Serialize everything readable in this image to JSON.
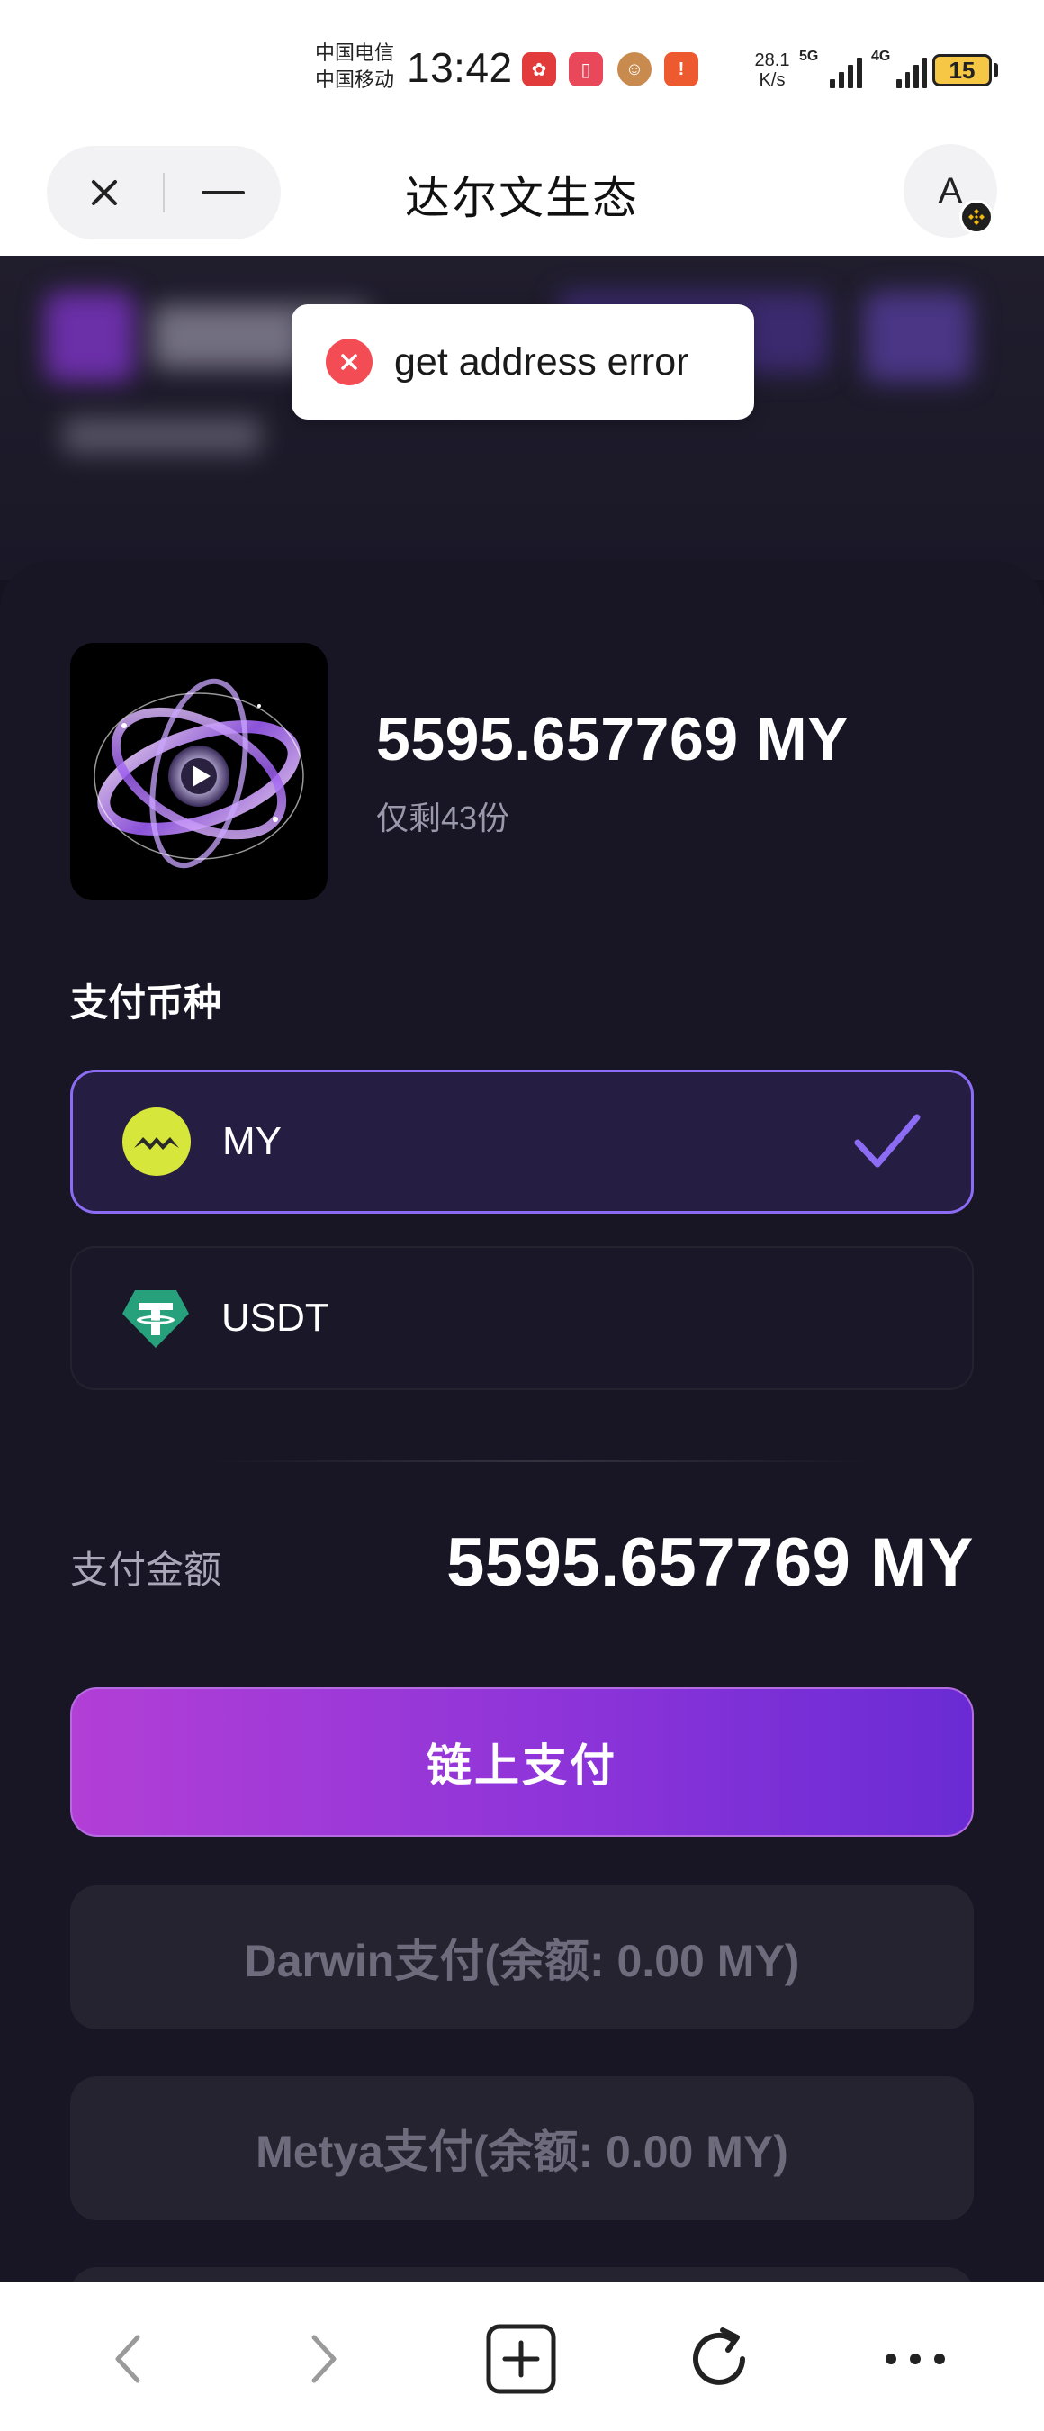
{
  "status_bar": {
    "carrier_1": "中国电信",
    "carrier_2": "中国移动",
    "time": "13:42",
    "net_speed_value": "28.1",
    "net_speed_unit": "K/s",
    "signal_1_label": "5G",
    "signal_2_label": "4G",
    "battery": "15"
  },
  "browser": {
    "title": "达尔文生态",
    "avatar_letter": "A"
  },
  "toast": {
    "message": "get address error"
  },
  "product": {
    "price": "5595.657769 MY",
    "remaining": "仅剩43份"
  },
  "payment_currency": {
    "label": "支付币种",
    "options": [
      {
        "label": "MY",
        "icon": "my-coin-icon",
        "selected": true
      },
      {
        "label": "USDT",
        "icon": "usdt-icon",
        "selected": false
      }
    ]
  },
  "amount": {
    "label": "支付金额",
    "value": "5595.657769 MY"
  },
  "actions": {
    "onchain_pay": "链上支付",
    "darwin_pay": "Darwin支付(余额: 0.00 MY)",
    "metya_pay": "Metya支付(余额: 0.00 MY)"
  },
  "colors": {
    "accent_purple": "#8c6cf4",
    "button_gradient_start": "#b23fd6",
    "button_gradient_end": "#6a2bd4",
    "error_red": "#f44c55",
    "usdt_green": "#26a17b",
    "my_coin_yellow": "#d7e63a"
  }
}
